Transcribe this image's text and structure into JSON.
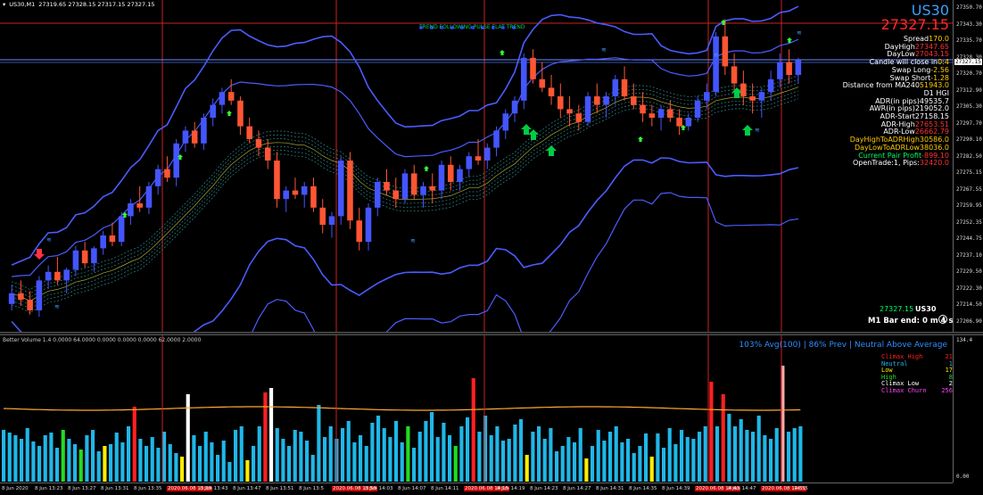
{
  "header": {
    "symbol_tf": "US30,M1",
    "ohlc": "27319.65 27328.15 27317.15 27327.15"
  },
  "chart": {
    "symbol": "US30",
    "price": "27327.15",
    "trend_label": "TREND FOLLOWING  PULSE  FLAT TREND",
    "info": [
      {
        "label": "Spread",
        "value": "170.0",
        "label_color": "#ffffff",
        "value_color": "#ffcc00"
      },
      {
        "label": "DayHigh",
        "value": "27347.65",
        "label_color": "#ffffff",
        "value_color": "#ff3333"
      },
      {
        "label": "DayLow",
        "value": "27043.15",
        "label_color": "#ffffff",
        "value_color": "#ff3333"
      },
      {
        "label": "Candle will close in",
        "value": "0:4",
        "label_color": "#ffffff",
        "value_color": "#ffcc00"
      },
      {
        "label": "Swap Long",
        "value": "-2.56",
        "label_color": "#ffffff",
        "value_color": "#ffcc00"
      },
      {
        "label": "Swap Short",
        "value": "-1.28",
        "label_color": "#ffffff",
        "value_color": "#ffcc00"
      },
      {
        "label": "Distance from MA240",
        "value": "51943.0",
        "label_color": "#ffffff",
        "value_color": "#ffcc00"
      },
      {
        "label": "D1 HGI",
        "value": "",
        "label_color": "#ffffff",
        "value_color": "#ffffff"
      },
      {
        "label": "ADR(in pips)",
        "value": "49535.7",
        "label_color": "#ffffff",
        "value_color": "#ffffff"
      },
      {
        "label": "AWR(in pips)",
        "value": "219052.0",
        "label_color": "#ffffff",
        "value_color": "#ffffff"
      },
      {
        "label": "ADR-Start",
        "value": "27158.15",
        "label_color": "#ffffff",
        "value_color": "#ffffff"
      },
      {
        "label": "ADR-High",
        "value": "27653.51",
        "label_color": "#ffffff",
        "value_color": "#ff3333"
      },
      {
        "label": "ADR-Low",
        "value": "26662.79",
        "label_color": "#ffffff",
        "value_color": "#ff3333"
      },
      {
        "label": "DayHighToADRHigh",
        "value": "30586.0",
        "label_color": "#ffcc00",
        "value_color": "#ffcc00"
      },
      {
        "label": "DayLowToADRLow",
        "value": "38036.0",
        "label_color": "#ffcc00",
        "value_color": "#ffcc00"
      },
      {
        "label": "Current Pair Profit",
        "value": "-899.10",
        "label_color": "#00ff66",
        "value_color": "#ff3333"
      },
      {
        "label": "OpenTrade:1, Pips:",
        "value": "32420.0",
        "label_color": "#ffffff",
        "value_color": "#ff3333"
      }
    ],
    "bottom_price": "27327.15",
    "bottom_symbol": "US30",
    "bar_end": "M1 Bar end: 0 m 4 s",
    "price_ticks": [
      "27350.70",
      "27343.30",
      "27335.70",
      "27328.30",
      "27320.70",
      "27312.90",
      "27305.30",
      "27297.70",
      "27290.10",
      "27282.50",
      "27275.15",
      "27267.55",
      "27259.95",
      "27252.35",
      "27244.75",
      "27237.10",
      "27229.50",
      "27222.30",
      "27214.50",
      "27206.90"
    ],
    "current_price_tag": "27327.15"
  },
  "volume": {
    "header": "Better Volume 1.4 0.0000 64.0000 0.0000 0.0000 0.0000 62.0000 2.0000",
    "status": "103% Avg(100) | 86% Prev | Neutral Above Average",
    "legend": [
      {
        "label": "Climax High",
        "count": "21",
        "color": "#ff2020"
      },
      {
        "label": "Neutral",
        "count": "1",
        "color": "#1fb7e8"
      },
      {
        "label": "Low",
        "count": "17",
        "color": "#ffee00"
      },
      {
        "label": "High",
        "count": "8",
        "color": "#22dd22"
      },
      {
        "label": "Climax Low",
        "count": "2",
        "color": "#ffffff"
      },
      {
        "label": "Climax Churn",
        "count": "256",
        "color": "#ff44ff"
      }
    ],
    "axis_ticks": [
      "134.4",
      "0.00"
    ]
  },
  "time_axis": [
    {
      "label": "8 Jun 2020",
      "red": false
    },
    {
      "label": "8 Jun 13:23",
      "red": false
    },
    {
      "label": "8 Jun 13:27",
      "red": false
    },
    {
      "label": "8 Jun 13:31",
      "red": false
    },
    {
      "label": "8 Jun 13:35",
      "red": false
    },
    {
      "label": "2020.06.08 13:39",
      "red": true
    },
    {
      "label": "8 Jun 13:43",
      "red": false
    },
    {
      "label": "8 Jun 13:47",
      "red": false
    },
    {
      "label": "8 Jun 13:51",
      "red": false
    },
    {
      "label": "8 Jun 13:5",
      "red": false
    },
    {
      "label": "2020.06.08 13:59",
      "red": true
    },
    {
      "label": "8 Jun 14:03",
      "red": false
    },
    {
      "label": "8 Jun 14:07",
      "red": false
    },
    {
      "label": "8 Jun 14:11",
      "red": false
    },
    {
      "label": "2020.06.08 14:15",
      "red": true
    },
    {
      "label": "8 Jun 14:19",
      "red": false
    },
    {
      "label": "8 Jun 14:23",
      "red": false
    },
    {
      "label": "8 Jun 14:27",
      "red": false
    },
    {
      "label": "8 Jun 14:31",
      "red": false
    },
    {
      "label": "8 Jun 14:35",
      "red": false
    },
    {
      "label": "8 Jun 14:39",
      "red": false
    },
    {
      "label": "2020.06.08 14:43",
      "red": true
    },
    {
      "label": "8 Jun 14:47",
      "red": false
    },
    {
      "label": "2020.06.08 14:51",
      "red": true
    },
    {
      "label": "14:55",
      "red": false
    }
  ],
  "colors": {
    "bull": "#4455ff",
    "bear": "#ff5533",
    "doji": "#ffee00",
    "band": "#4a5cff",
    "signal": "#00cc44",
    "sell": "#ff3344",
    "vline": "#cc2222",
    "hline": "#cc2222",
    "priceline": "#6a8cff"
  },
  "candles": [
    [
      27213,
      27222,
      27210,
      27218
    ],
    [
      27218,
      27224,
      27212,
      27215
    ],
    [
      27215,
      27219,
      27208,
      27210
    ],
    [
      27210,
      27226,
      27207,
      27224
    ],
    [
      27224,
      27231,
      27220,
      27228
    ],
    [
      27228,
      27235,
      27222,
      27224
    ],
    [
      27224,
      27230,
      27218,
      27229
    ],
    [
      27229,
      27240,
      27226,
      27238
    ],
    [
      27238,
      27242,
      27230,
      27232
    ],
    [
      27232,
      27240,
      27228,
      27239
    ],
    [
      27239,
      27247,
      27236,
      27245
    ],
    [
      27245,
      27251,
      27240,
      27242
    ],
    [
      27242,
      27256,
      27240,
      27254
    ],
    [
      27254,
      27262,
      27250,
      27260
    ],
    [
      27260,
      27268,
      27256,
      27258
    ],
    [
      27258,
      27270,
      27255,
      27268
    ],
    [
      27268,
      27278,
      27264,
      27276
    ],
    [
      27276,
      27282,
      27270,
      27272
    ],
    [
      27272,
      27290,
      27268,
      27288
    ],
    [
      27288,
      27296,
      27284,
      27294
    ],
    [
      27294,
      27298,
      27286,
      27288
    ],
    [
      27288,
      27302,
      27285,
      27300
    ],
    [
      27300,
      27309,
      27296,
      27306
    ],
    [
      27306,
      27314,
      27302,
      27312
    ],
    [
      27312,
      27318,
      27306,
      27308
    ],
    [
      27308,
      27310,
      27292,
      27296
    ],
    [
      27296,
      27300,
      27288,
      27290
    ],
    [
      27290,
      27294,
      27282,
      27286
    ],
    [
      27286,
      27290,
      27276,
      27280
    ],
    [
      27280,
      27284,
      27258,
      27262
    ],
    [
      27262,
      27268,
      27256,
      27266
    ],
    [
      27266,
      27272,
      27262,
      27264
    ],
    [
      27264,
      27270,
      27258,
      27268
    ],
    [
      27268,
      27272,
      27256,
      27258
    ],
    [
      27258,
      27262,
      27246,
      27250
    ],
    [
      27250,
      27256,
      27244,
      27254
    ],
    [
      27254,
      27282,
      27250,
      27280
    ],
    [
      27280,
      27284,
      27248,
      27252
    ],
    [
      27252,
      27258,
      27238,
      27242
    ],
    [
      27242,
      27260,
      27238,
      27258
    ],
    [
      27258,
      27272,
      27254,
      27270
    ],
    [
      27270,
      27276,
      27264,
      27266
    ],
    [
      27266,
      27272,
      27258,
      27262
    ],
    [
      27262,
      27276,
      27260,
      27274
    ],
    [
      27274,
      27278,
      27262,
      27264
    ],
    [
      27264,
      27270,
      27258,
      27268
    ],
    [
      27268,
      27274,
      27260,
      27266
    ],
    [
      27266,
      27280,
      27262,
      27278
    ],
    [
      27278,
      27282,
      27266,
      27270
    ],
    [
      27270,
      27278,
      27266,
      27276
    ],
    [
      27276,
      27284,
      27272,
      27282
    ],
    [
      27282,
      27290,
      27278,
      27280
    ],
    [
      27280,
      27288,
      27276,
      27286
    ],
    [
      27286,
      27296,
      27282,
      27294
    ],
    [
      27294,
      27304,
      27290,
      27302
    ],
    [
      27302,
      27310,
      27298,
      27308
    ],
    [
      27308,
      27330,
      27304,
      27328
    ],
    [
      27328,
      27332,
      27316,
      27318
    ],
    [
      27318,
      27326,
      27312,
      27314
    ],
    [
      27314,
      27320,
      27306,
      27310
    ],
    [
      27310,
      27316,
      27300,
      27304
    ],
    [
      27304,
      27310,
      27296,
      27302
    ],
    [
      27302,
      27306,
      27294,
      27298
    ],
    [
      27298,
      27312,
      27296,
      27310
    ],
    [
      27310,
      27316,
      27302,
      27306
    ],
    [
      27306,
      27312,
      27300,
      27310
    ],
    [
      27310,
      27320,
      27306,
      27318
    ],
    [
      27318,
      27324,
      27308,
      27310
    ],
    [
      27310,
      27316,
      27304,
      27306
    ],
    [
      27306,
      27312,
      27298,
      27302
    ],
    [
      27302,
      27306,
      27296,
      27300
    ],
    [
      27300,
      27306,
      27294,
      27304
    ],
    [
      27304,
      27308,
      27298,
      27300
    ],
    [
      27300,
      27304,
      27292,
      27296
    ],
    [
      27296,
      27302,
      27294,
      27300
    ],
    [
      27300,
      27310,
      27298,
      27308
    ],
    [
      27308,
      27316,
      27304,
      27312
    ],
    [
      27312,
      27340,
      27310,
      27338
    ],
    [
      27338,
      27346,
      27320,
      27324
    ],
    [
      27324,
      27330,
      27312,
      27316
    ],
    [
      27316,
      27322,
      27306,
      27310
    ],
    [
      27310,
      27316,
      27302,
      27308
    ],
    [
      27308,
      27314,
      27300,
      27312
    ],
    [
      27312,
      27322,
      27308,
      27318
    ],
    [
      27318,
      27330,
      27314,
      27326
    ],
    [
      27326,
      27332,
      27316,
      27320
    ],
    [
      27320,
      27328,
      27316,
      27327
    ]
  ],
  "volumes": [
    [
      58,
      "#1fb7e8"
    ],
    [
      55,
      "#1fb7e8"
    ],
    [
      52,
      "#1fb7e8"
    ],
    [
      48,
      "#1fb7e8"
    ],
    [
      60,
      "#1fb7e8"
    ],
    [
      45,
      "#1fb7e8"
    ],
    [
      40,
      "#1fb7e8"
    ],
    [
      52,
      "#1fb7e8"
    ],
    [
      55,
      "#1fb7e8"
    ],
    [
      38,
      "#1fb7e8"
    ],
    [
      58,
      "#22dd22"
    ],
    [
      48,
      "#1fb7e8"
    ],
    [
      42,
      "#1fb7e8"
    ],
    [
      36,
      "#22dd22"
    ],
    [
      52,
      "#1fb7e8"
    ],
    [
      58,
      "#1fb7e8"
    ],
    [
      34,
      "#1fb7e8"
    ],
    [
      40,
      "#ffee00"
    ],
    [
      42,
      "#1fb7e8"
    ],
    [
      55,
      "#1fb7e8"
    ],
    [
      44,
      "#1fb7e8"
    ],
    [
      62,
      "#1fb7e8"
    ],
    [
      84,
      "#ff2020"
    ],
    [
      48,
      "#1fb7e8"
    ],
    [
      40,
      "#1fb7e8"
    ],
    [
      50,
      "#1fb7e8"
    ],
    [
      38,
      "#1fb7e8"
    ],
    [
      56,
      "#1fb7e8"
    ],
    [
      42,
      "#1fb7e8"
    ],
    [
      32,
      "#1fb7e8"
    ],
    [
      28,
      "#ffee00"
    ],
    [
      98,
      "#ffffff"
    ],
    [
      52,
      "#1fb7e8"
    ],
    [
      40,
      "#1fb7e8"
    ],
    [
      56,
      "#1fb7e8"
    ],
    [
      44,
      "#1fb7e8"
    ],
    [
      30,
      "#1fb7e8"
    ],
    [
      46,
      "#1fb7e8"
    ],
    [
      22,
      "#1fb7e8"
    ],
    [
      58,
      "#1fb7e8"
    ],
    [
      62,
      "#1fb7e8"
    ],
    [
      24,
      "#ffee00"
    ],
    [
      40,
      "#1fb7e8"
    ],
    [
      62,
      "#1fb7e8"
    ],
    [
      100,
      "#ff2020"
    ],
    [
      105,
      "#ffffff"
    ],
    [
      60,
      "#1fb7e8"
    ],
    [
      48,
      "#1fb7e8"
    ],
    [
      40,
      "#1fb7e8"
    ],
    [
      58,
      "#1fb7e8"
    ],
    [
      56,
      "#1fb7e8"
    ],
    [
      46,
      "#1fb7e8"
    ],
    [
      30,
      "#1fb7e8"
    ],
    [
      86,
      "#1fb7e8"
    ],
    [
      50,
      "#1fb7e8"
    ],
    [
      62,
      "#1fb7e8"
    ],
    [
      48,
      "#1fb7e8"
    ],
    [
      60,
      "#1fb7e8"
    ],
    [
      68,
      "#1fb7e8"
    ],
    [
      44,
      "#1fb7e8"
    ],
    [
      52,
      "#1fb7e8"
    ],
    [
      40,
      "#1fb7e8"
    ],
    [
      66,
      "#1fb7e8"
    ],
    [
      74,
      "#1fb7e8"
    ],
    [
      60,
      "#1fb7e8"
    ],
    [
      50,
      "#1fb7e8"
    ],
    [
      68,
      "#1fb7e8"
    ],
    [
      44,
      "#1fb7e8"
    ],
    [
      62,
      "#22dd22"
    ],
    [
      38,
      "#1fb7e8"
    ],
    [
      56,
      "#1fb7e8"
    ],
    [
      68,
      "#1fb7e8"
    ],
    [
      78,
      "#1fb7e8"
    ],
    [
      50,
      "#1fb7e8"
    ],
    [
      66,
      "#1fb7e8"
    ],
    [
      52,
      "#1fb7e8"
    ],
    [
      40,
      "#22dd22"
    ],
    [
      62,
      "#1fb7e8"
    ],
    [
      72,
      "#1fb7e8"
    ],
    [
      116,
      "#ff2020"
    ],
    [
      56,
      "#1fb7e8"
    ],
    [
      74,
      "#1fb7e8"
    ],
    [
      52,
      "#1fb7e8"
    ],
    [
      62,
      "#1fb7e8"
    ],
    [
      46,
      "#1fb7e8"
    ],
    [
      48,
      "#1fb7e8"
    ],
    [
      64,
      "#1fb7e8"
    ],
    [
      70,
      "#1fb7e8"
    ],
    [
      30,
      "#ffee00"
    ],
    [
      56,
      "#1fb7e8"
    ],
    [
      62,
      "#1fb7e8"
    ],
    [
      48,
      "#1fb7e8"
    ],
    [
      60,
      "#1fb7e8"
    ],
    [
      34,
      "#1fb7e8"
    ],
    [
      40,
      "#1fb7e8"
    ],
    [
      50,
      "#1fb7e8"
    ],
    [
      44,
      "#1fb7e8"
    ],
    [
      60,
      "#1fb7e8"
    ],
    [
      26,
      "#ffee00"
    ],
    [
      40,
      "#1fb7e8"
    ],
    [
      58,
      "#1fb7e8"
    ],
    [
      46,
      "#1fb7e8"
    ],
    [
      56,
      "#1fb7e8"
    ],
    [
      62,
      "#1fb7e8"
    ],
    [
      44,
      "#1fb7e8"
    ],
    [
      48,
      "#1fb7e8"
    ],
    [
      32,
      "#1fb7e8"
    ],
    [
      40,
      "#1fb7e8"
    ],
    [
      54,
      "#1fb7e8"
    ],
    [
      28,
      "#ffee00"
    ],
    [
      54,
      "#1fb7e8"
    ],
    [
      38,
      "#1fb7e8"
    ],
    [
      60,
      "#1fb7e8"
    ],
    [
      42,
      "#1fb7e8"
    ],
    [
      58,
      "#1fb7e8"
    ],
    [
      50,
      "#1fb7e8"
    ],
    [
      48,
      "#1fb7e8"
    ],
    [
      56,
      "#1fb7e8"
    ],
    [
      62,
      "#1fb7e8"
    ],
    [
      112,
      "#ff2020"
    ],
    [
      62,
      "#1fb7e8"
    ],
    [
      98,
      "#ff2020"
    ],
    [
      76,
      "#1fb7e8"
    ],
    [
      62,
      "#1fb7e8"
    ],
    [
      70,
      "#1fb7e8"
    ],
    [
      58,
      "#1fb7e8"
    ],
    [
      56,
      "#1fb7e8"
    ],
    [
      74,
      "#1fb7e8"
    ],
    [
      52,
      "#1fb7e8"
    ],
    [
      48,
      "#1fb7e8"
    ],
    [
      60,
      "#1fb7e8"
    ],
    [
      130,
      "#ffaaaa"
    ],
    [
      56,
      "#1fb7e8"
    ],
    [
      60,
      "#1fb7e8"
    ],
    [
      62,
      "#1fb7e8"
    ]
  ]
}
